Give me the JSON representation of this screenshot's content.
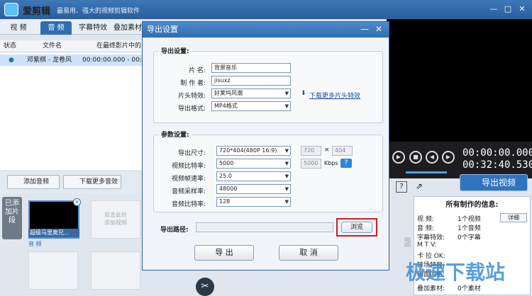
{
  "app": {
    "name": "爱剪辑",
    "slogan": "最易用、强大的视频剪辑软件"
  },
  "window_controls": {
    "minimize": "—",
    "maximize": "□",
    "close": "✕"
  },
  "tabs": [
    {
      "label": "视 频"
    },
    {
      "label": "音 频"
    },
    {
      "label": "字幕特效"
    },
    {
      "label": "叠加素材"
    }
  ],
  "list": {
    "headers": [
      "状态",
      "文件名",
      "在最终影片中的"
    ],
    "rows": [
      {
        "status": "●",
        "name": "邓紫棋 - 龙卷风",
        "time": "00:00:00.000 - 00:0"
      }
    ]
  },
  "audio_toolbar": {
    "add_audio": "添加音频",
    "download_effects": "下载更多音效"
  },
  "player": {
    "current_time": "00:00:00.000",
    "total_time": "00:32:40.530"
  },
  "export_video_label": "导出视频",
  "timeline": {
    "side_label": "已添加片段",
    "clip_label": "超级马里奥兄...",
    "placeholder": "双击此处\n添加视频",
    "audio_track_label": "音 频"
  },
  "info_panel": {
    "title": "所有制作的信息:",
    "detail_button": "详细",
    "lines": [
      {
        "label": "视      频:",
        "value": "1个视频"
      },
      {
        "label": "音      频:",
        "value": "1个音频"
      },
      {
        "label": "字幕特效:",
        "value": "0个字幕"
      },
      {
        "label": "M   T V:",
        "value": ""
      },
      {
        "label": "卡 拉 OK:",
        "value": ""
      },
      {
        "label": "转场特效:",
        "value": ""
      },
      {
        "label": "画面风格:",
        "value": ""
      },
      {
        "label": "叠加素材:",
        "value": "0个素材"
      }
    ]
  },
  "dialog": {
    "title": "导出设置",
    "help_btn": "—",
    "close_btn": "✕",
    "export_section": "导出设置:",
    "title_label": "片    名:",
    "title_value": "背景音乐",
    "author_label": "制 作 者:",
    "author_value": "jisuxz",
    "intro_effect_label": "片头特效:",
    "intro_effect_value": "好莱坞风潮",
    "download_link": "下载更多片头特效",
    "format_label": "导出格式:",
    "format_value": "MP4格式",
    "param_section": "参数设置:",
    "size_label": "导出尺寸:",
    "size_value": "720*404(480P 16:9)",
    "size_w": "720",
    "size_x": "×",
    "size_h": "404",
    "vbitrate_label": "视频比特率:",
    "vbitrate_value": "5000",
    "vbitrate_input": "5000",
    "kbps": "Kbps",
    "help_icon": "?",
    "fps_label": "视频帧速率:",
    "fps_value": "25.0",
    "samplerate_label": "音频采样率:",
    "samplerate_value": "48000",
    "abitrate_label": "音频比特率:",
    "abitrate_value": "128",
    "path_label": "导出路径:",
    "path_value": "",
    "browse_btn": "浏览",
    "export_btn": "导 出",
    "cancel_btn": "取 消"
  },
  "watermark": "极速下载站",
  "colors": {
    "accent": "#2f6eb0",
    "highlight": "#cc1f1f"
  }
}
